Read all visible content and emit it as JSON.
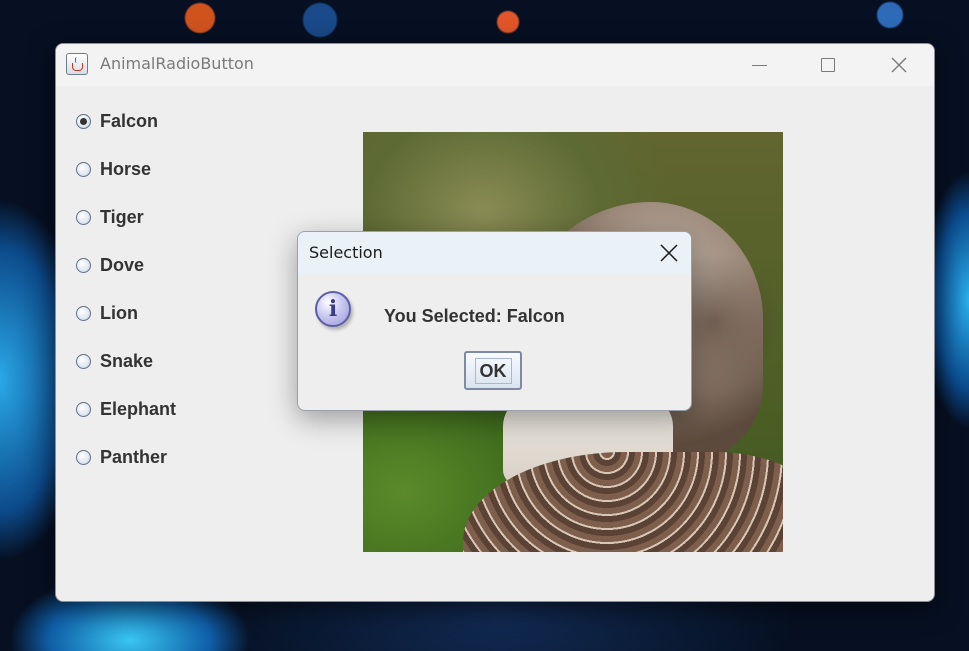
{
  "window": {
    "title": "AnimalRadioButton"
  },
  "radio_group": {
    "selected": "Falcon",
    "options": [
      {
        "label": "Falcon",
        "checked": true
      },
      {
        "label": "Horse",
        "checked": false
      },
      {
        "label": "Tiger",
        "checked": false
      },
      {
        "label": "Dove",
        "checked": false
      },
      {
        "label": "Lion",
        "checked": false
      },
      {
        "label": "Snake",
        "checked": false
      },
      {
        "label": "Elephant",
        "checked": false
      },
      {
        "label": "Panther",
        "checked": false
      }
    ]
  },
  "dialog": {
    "title": "Selection",
    "message": "You Selected: Falcon",
    "ok_label": "OK",
    "icon": "info-icon",
    "icon_glyph": "i"
  },
  "colors": {
    "accent": "#5e5da8",
    "text": "#333333",
    "window_bg": "#eeeeee",
    "dialog_titlebar_bg": "#eaf2f8"
  }
}
